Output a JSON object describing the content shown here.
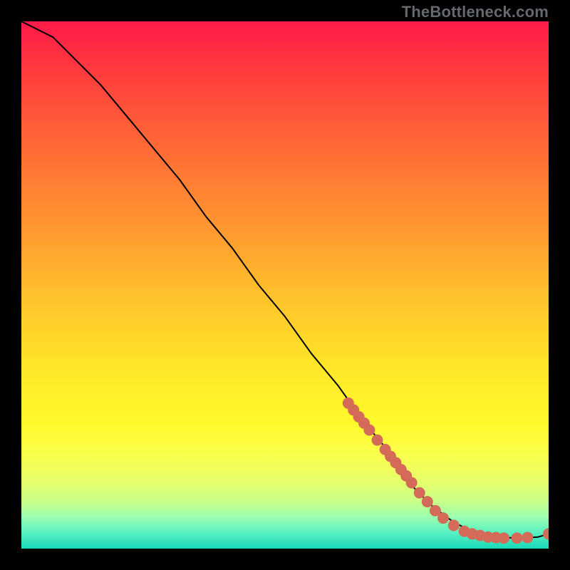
{
  "attribution": "TheBottleneck.com",
  "chart_data": {
    "type": "line",
    "title": "",
    "xlabel": "",
    "ylabel": "",
    "xlim": [
      0,
      100
    ],
    "ylim": [
      0,
      100
    ],
    "grid": false,
    "legend": false,
    "series": [
      {
        "name": "curve",
        "x": [
          0,
          6,
          10,
          15,
          20,
          25,
          30,
          35,
          40,
          45,
          50,
          55,
          60,
          65,
          70,
          74,
          78,
          82,
          86,
          90,
          94,
          98,
          100
        ],
        "y": [
          100,
          97,
          93,
          88,
          82,
          76,
          70,
          63,
          57,
          50,
          44,
          37,
          31,
          24,
          18,
          12,
          8,
          5,
          3,
          2.2,
          2.0,
          2.2,
          2.8
        ]
      }
    ],
    "markers": {
      "name": "dots",
      "color": "#d46a58",
      "radius_px": 8,
      "points": [
        {
          "x": 62,
          "y": 27.6
        },
        {
          "x": 63,
          "y": 26.3
        },
        {
          "x": 64,
          "y": 25.0
        },
        {
          "x": 65,
          "y": 23.8
        },
        {
          "x": 66,
          "y": 22.5
        },
        {
          "x": 67.5,
          "y": 20.6
        },
        {
          "x": 69,
          "y": 18.8
        },
        {
          "x": 70,
          "y": 17.5
        },
        {
          "x": 71,
          "y": 16.3
        },
        {
          "x": 72,
          "y": 15.0
        },
        {
          "x": 73,
          "y": 13.8
        },
        {
          "x": 74,
          "y": 12.5
        },
        {
          "x": 75.5,
          "y": 10.6
        },
        {
          "x": 77,
          "y": 8.9
        },
        {
          "x": 78.5,
          "y": 7.2
        },
        {
          "x": 80,
          "y": 5.8
        },
        {
          "x": 82,
          "y": 4.4
        },
        {
          "x": 84,
          "y": 3.3
        },
        {
          "x": 85.5,
          "y": 2.8
        },
        {
          "x": 87,
          "y": 2.5
        },
        {
          "x": 88.5,
          "y": 2.2
        },
        {
          "x": 90,
          "y": 2.1
        },
        {
          "x": 91.5,
          "y": 2.0
        },
        {
          "x": 94,
          "y": 2.0
        },
        {
          "x": 96,
          "y": 2.1
        },
        {
          "x": 100,
          "y": 2.8
        }
      ]
    }
  }
}
